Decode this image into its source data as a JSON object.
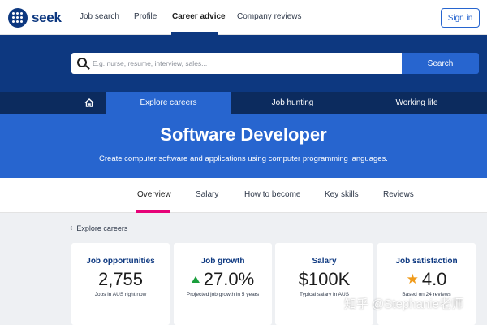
{
  "brand": {
    "name": "seek"
  },
  "topnav": {
    "items": [
      {
        "label": "Job search"
      },
      {
        "label": "Profile"
      },
      {
        "label": "Career advice"
      },
      {
        "label": "Company reviews"
      }
    ],
    "active": "Career advice",
    "signin_label": "Sign in"
  },
  "search": {
    "placeholder": "E.g. nurse, resume, interview, sales...",
    "value": "",
    "button_label": "Search"
  },
  "section_tabs": [
    {
      "label": "Explore careers"
    },
    {
      "label": "Job hunting"
    },
    {
      "label": "Working life"
    }
  ],
  "hero": {
    "title": "Software Developer",
    "subtitle": "Create computer software and applications using computer programming languages."
  },
  "subtabs": [
    {
      "label": "Overview"
    },
    {
      "label": "Salary"
    },
    {
      "label": "How to become"
    },
    {
      "label": "Key skills"
    },
    {
      "label": "Reviews"
    }
  ],
  "breadcrumb": {
    "label": "Explore careers"
  },
  "cards": [
    {
      "title": "Job opportunities",
      "value": "2,755",
      "caption": "Jobs in AUS right now"
    },
    {
      "title": "Job growth",
      "value": "27.0%",
      "caption": "Projected job growth in 5 years"
    },
    {
      "title": "Salary",
      "value": "$100K",
      "caption": "Typical salary in AUS"
    },
    {
      "title": "Job satisfaction",
      "value": "4.0",
      "caption": "Based on 24 reviews"
    }
  ],
  "watermark": "知乎 @Stephanie老师",
  "colors": {
    "brand_navy": "#0d3880",
    "accent_blue": "#2765cf",
    "dark_band": "#0c2b5e",
    "tab_underline_pink": "#e60278",
    "growth_green": "#1a9e3c",
    "star_orange": "#f09b1b"
  },
  "icons": [
    "seek-logo-icon",
    "search-icon",
    "home-icon",
    "chevron-left-icon",
    "up-arrow-icon",
    "star-icon"
  ]
}
